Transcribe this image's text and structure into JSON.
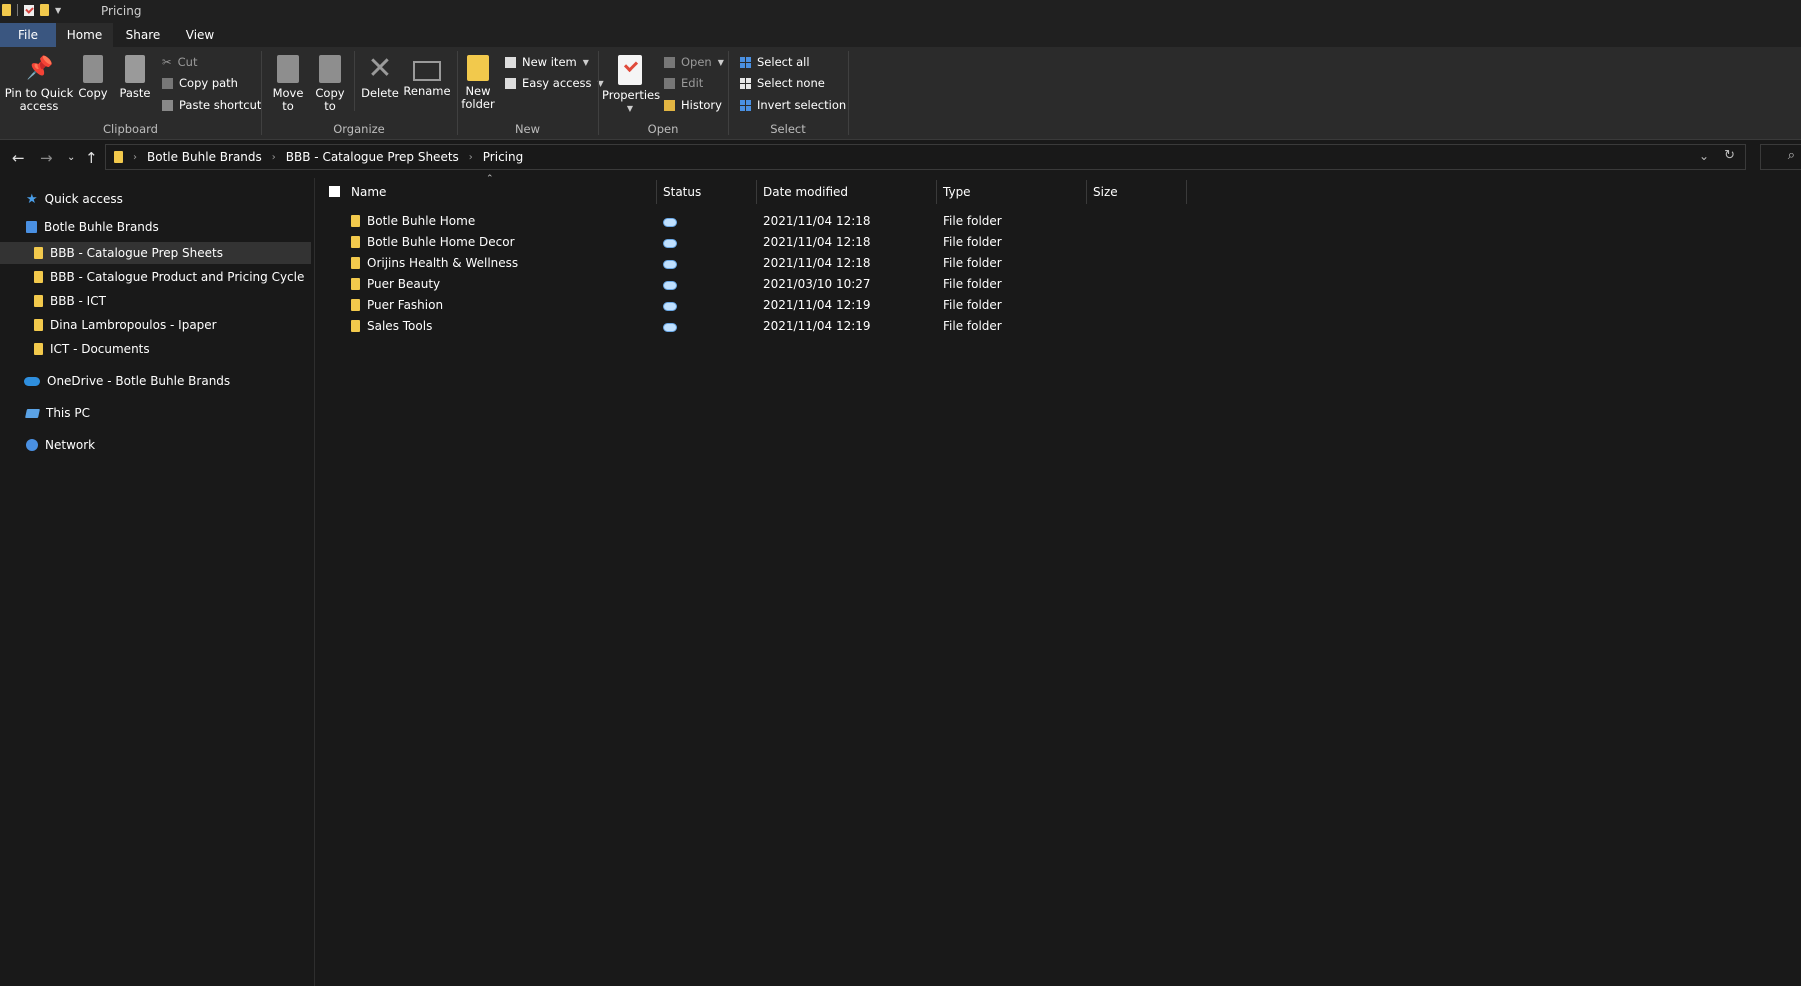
{
  "window": {
    "title": "Pricing"
  },
  "tabs": [
    {
      "label": "File"
    },
    {
      "label": "Home"
    },
    {
      "label": "Share"
    },
    {
      "label": "View"
    }
  ],
  "ribbon": {
    "clipboard": {
      "pin_line1": "Pin to Quick",
      "pin_line2": "access",
      "copy": "Copy",
      "paste": "Paste",
      "cut": "Cut",
      "copy_path": "Copy path",
      "paste_shortcut": "Paste shortcut",
      "label": "Clipboard"
    },
    "organize": {
      "move_line1": "Move",
      "move_line2": "to",
      "copy_line1": "Copy",
      "copy_line2": "to",
      "delete": "Delete",
      "rename": "Rename",
      "label": "Organize"
    },
    "new": {
      "new_folder_line1": "New",
      "new_folder_line2": "folder",
      "new_item": "New item",
      "easy_access": "Easy access",
      "label": "New"
    },
    "open": {
      "properties": "Properties",
      "open": "Open",
      "edit": "Edit",
      "history": "History",
      "label": "Open"
    },
    "select": {
      "select_all": "Select all",
      "select_none": "Select none",
      "invert_selection": "Invert selection",
      "label": "Select"
    }
  },
  "address": {
    "crumbs": [
      "Botle Buhle Brands",
      "BBB - Catalogue Prep Sheets",
      "Pricing"
    ]
  },
  "nav": {
    "quick_access": "Quick access",
    "org": "Botle Buhle Brands",
    "folders": [
      "BBB - Catalogue Prep Sheets",
      "BBB - Catalogue Product and Pricing Cycle",
      "BBB - ICT",
      "Dina Lambropoulos - Ipaper",
      "ICT - Documents"
    ],
    "onedrive": "OneDrive - Botle Buhle Brands",
    "this_pc": "This PC",
    "network": "Network"
  },
  "columns": {
    "name": "Name",
    "status": "Status",
    "date": "Date modified",
    "type": "Type",
    "size": "Size"
  },
  "files": [
    {
      "name": "Botle Buhle Home",
      "date": "2021/11/04 12:18",
      "type": "File folder"
    },
    {
      "name": "Botle Buhle Home Decor",
      "date": "2021/11/04 12:18",
      "type": "File folder"
    },
    {
      "name": "Orijins Health & Wellness",
      "date": "2021/11/04 12:18",
      "type": "File folder"
    },
    {
      "name": "Puer Beauty",
      "date": "2021/03/10 10:27",
      "type": "File folder"
    },
    {
      "name": "Puer Fashion",
      "date": "2021/11/04 12:19",
      "type": "File folder"
    },
    {
      "name": "Sales Tools",
      "date": "2021/11/04 12:19",
      "type": "File folder"
    }
  ]
}
